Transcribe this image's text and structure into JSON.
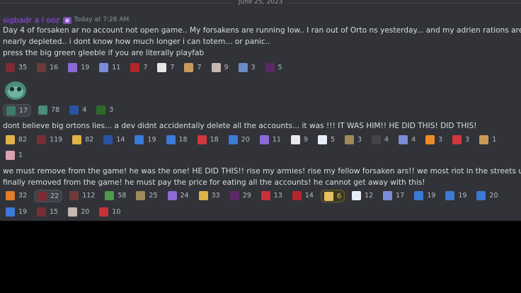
{
  "date_divider": "June 25, 2023",
  "message": {
    "username": "sigbadr a l ooz",
    "timestamp": "Today at 7:28 AM",
    "lines": [
      "Day 4 of forsaken ar   no account        not open game..  My  forsakens are running low..   I  ran out of Orto  ns yesterday...  and my adrien rations are",
      "nearly depleted.. i dont know how much longer i can totem... or panic..",
      "press the big green gleeble if you are literally playfab"
    ]
  },
  "reactions_row1": [
    {
      "icon": "demon-figure-icon",
      "color": "#7a2e33",
      "count": "35"
    },
    {
      "icon": "demon-figure-icon",
      "color": "#6d3a38",
      "count": "16"
    },
    {
      "icon": "purple-sparkle-icon",
      "color": "#8b6ad8",
      "count": "19"
    },
    {
      "icon": "knight-helmet-icon",
      "color": "#7b8cd9",
      "count": "11"
    },
    {
      "icon": "red-blob-icon",
      "color": "#b3262a",
      "count": "7"
    },
    {
      "icon": "poland-flag-icon",
      "color": "#e8e8e8",
      "count": "7"
    },
    {
      "icon": "dog-icon",
      "color": "#c79a5a",
      "count": "7"
    },
    {
      "icon": "cat-icon",
      "color": "#c8b6b0",
      "count": "9"
    },
    {
      "icon": "robot-icon",
      "color": "#6e8bc4",
      "count": "3"
    },
    {
      "icon": "dark-figure-icon",
      "color": "#5b2a66",
      "count": "5"
    }
  ],
  "reactions_row2": [
    {
      "icon": "gleeble-icon",
      "color": "#3e7a6a",
      "count": "17",
      "selected": true
    },
    {
      "icon": "gleeble-icon",
      "color": "#4a8b7a",
      "count": "78"
    },
    {
      "icon": "france-flag-icon",
      "color": "#2952a3",
      "count": "4"
    },
    {
      "icon": "green-cap-icon",
      "color": "#2d6b2a",
      "count": "3"
    }
  ],
  "message2_lines": [
    "dont believe big ortons lies... a dev didnt accidentally delete all the accounts... it was       !!! IT WAS HIM!! HE DID THIS!       DID THIS!"
  ],
  "reactions_row3": [
    {
      "icon": "pointing-hand-icon",
      "color": "#e0b347",
      "count": "82"
    },
    {
      "icon": "demon-figure-icon",
      "color": "#7a2e33",
      "count": "119"
    },
    {
      "icon": "pointing-hand-icon",
      "color": "#e0b347",
      "count": "82"
    },
    {
      "icon": "france-flag-icon",
      "color": "#2952a3",
      "count": "14"
    },
    {
      "icon": "letter-n-icon",
      "color": "#3b7ad6",
      "count": "19"
    },
    {
      "icon": "letter-m-icon",
      "color": "#3b7ad6",
      "count": "18"
    },
    {
      "icon": "letter-b-red-icon",
      "color": "#d4363e",
      "count": "18"
    },
    {
      "icon": "letter-b-blue-icon",
      "color": "#3b7ad6",
      "count": "20"
    },
    {
      "icon": "purple-mask-icon",
      "color": "#8b6ad8",
      "count": "11"
    },
    {
      "icon": "poland-flag-icon",
      "color": "#e8e8e8",
      "count": "9"
    },
    {
      "icon": "israel-flag-icon",
      "color": "#e8eef8",
      "count": "5"
    },
    {
      "icon": "small-figure-icon",
      "color": "#a08a5a",
      "count": "3"
    },
    {
      "icon": "dark-creature-icon",
      "color": "#444",
      "count": "4"
    },
    {
      "icon": "blue-creature-icon",
      "color": "#7b8cd9",
      "count": "4"
    },
    {
      "icon": "fire-icon",
      "color": "#f08a24",
      "count": "3"
    },
    {
      "icon": "letter-a-icon",
      "color": "#d4363e",
      "count": "3"
    },
    {
      "icon": "dog-icon",
      "color": "#c79a5a",
      "count": "1"
    }
  ],
  "reactions_row4": [
    {
      "icon": "pig-icon",
      "color": "#d9a3b0",
      "count": "1"
    }
  ],
  "message3_lines": [
    "we must remove       from the game! he was the one!  HE DID THIS!! rise my armies! rise my fellow forsaken ars!! we most riot in the streets until       is",
    "finally removed from the game! he must pay the price for eating all the accounts! he cannot get away with this!"
  ],
  "reactions_row5": [
    {
      "icon": "orange-blob-icon",
      "color": "#e07d2a",
      "count": "32"
    },
    {
      "icon": "demon-figure-icon",
      "color": "#7a2e33",
      "count": "22",
      "selected": true
    },
    {
      "icon": "demon-figure-icon",
      "color": "#6d3a38",
      "count": "112"
    },
    {
      "icon": "green-sparkle-icon",
      "color": "#4f9a4c",
      "count": "58"
    },
    {
      "icon": "small-figure-icon",
      "color": "#a08a5a",
      "count": "25"
    },
    {
      "icon": "purple-sparkle-icon",
      "color": "#8b6ad8",
      "count": "24"
    },
    {
      "icon": "laughing-face-icon",
      "color": "#e0b347",
      "count": "33"
    },
    {
      "icon": "dark-figure-icon",
      "color": "#5b2a66",
      "count": "29"
    },
    {
      "icon": "norway-flag-icon",
      "color": "#c8303a",
      "count": "13"
    },
    {
      "icon": "red-blob-icon",
      "color": "#b3262a",
      "count": "14"
    },
    {
      "icon": "corn-icon",
      "color": "#e7c160",
      "count": "6",
      "gold": true
    },
    {
      "icon": "israel-flag-icon",
      "color": "#e8eef8",
      "count": "12"
    },
    {
      "icon": "knight-helmet-icon",
      "color": "#7b8cd9",
      "count": "17"
    },
    {
      "icon": "letter-l-icon",
      "color": "#3b7ad6",
      "count": "19"
    },
    {
      "icon": "letter-i-icon",
      "color": "#3b7ad6",
      "count": "19"
    },
    {
      "icon": "letter-k-icon",
      "color": "#3b7ad6",
      "count": "20"
    }
  ],
  "reactions_row6": [
    {
      "icon": "letter-e-icon",
      "color": "#3b7ad6",
      "count": "19"
    },
    {
      "icon": "demon-figure-icon",
      "color": "#7a2e33",
      "count": "15"
    },
    {
      "icon": "cat-icon",
      "color": "#c8b6b0",
      "count": "20"
    },
    {
      "icon": "red-cow-icon",
      "color": "#c8303a",
      "count": "10"
    }
  ]
}
